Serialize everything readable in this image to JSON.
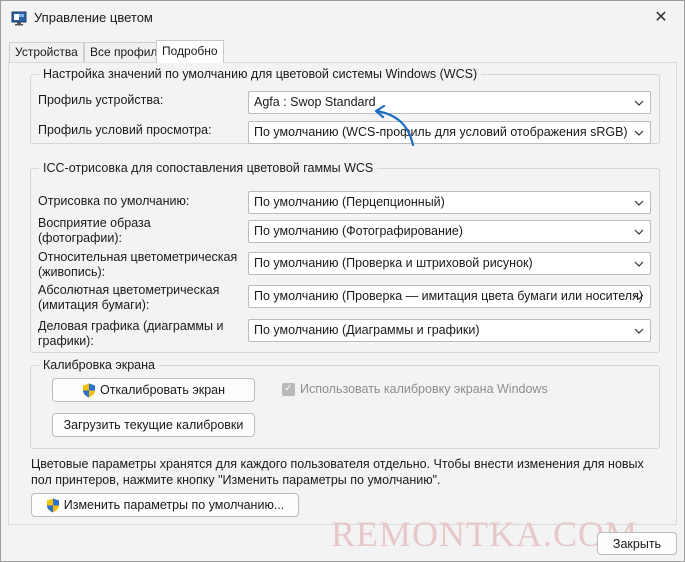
{
  "window": {
    "title": "Управление цветом",
    "close_glyph": "✕"
  },
  "tabs": [
    {
      "label": "Устройства",
      "active": false
    },
    {
      "label": "Все профили",
      "active": false
    },
    {
      "label": "Подробно",
      "active": true
    }
  ],
  "wcs_defaults": {
    "legend": "Настройка значений по умолчанию для цветовой системы Windows (WCS)",
    "rows": [
      {
        "label": "Профиль устройства:",
        "value": "Agfa : Swop Standard"
      },
      {
        "label": "Профиль условий просмотра:",
        "value": "По умолчанию (WCS-профиль для условий отображения sRGB)"
      }
    ]
  },
  "icc_mapping": {
    "legend": "ICC-отрисовка для сопоставления цветовой гаммы WCS",
    "rows": [
      {
        "label": "Отрисовка по умолчанию:",
        "value": "По умолчанию (Перцепционный)"
      },
      {
        "label": "Восприятие образа\n(фотографии):",
        "value": "По умолчанию (Фотографирование)"
      },
      {
        "label": "Относительная цветометрическая\n(живопись):",
        "value": "По умолчанию (Проверка и штриховой рисунок)"
      },
      {
        "label": "Абсолютная цветометрическая\n(имитация бумаги):",
        "value": "По умолчанию (Проверка — имитация цвета бумаги или носителя)"
      },
      {
        "label": "Деловая графика (диаграммы и\nграфики):",
        "value": "По умолчанию (Диаграммы и графики)"
      }
    ]
  },
  "calibration": {
    "legend": "Калибровка экрана",
    "calibrate_button": "Откалибровать экран",
    "load_button": "Загрузить текущие калибровки",
    "use_windows_calibration_label": "Использовать калибровку экрана Windows",
    "use_windows_calibration_checked": true
  },
  "info_text": "Цветовые параметры хранятся для каждого пользователя отдельно. Чтобы внести изменения для новых пол принтеров, нажмите кнопку \"Изменить параметры по умолчанию\".",
  "change_defaults_button": "Изменить параметры по умолчанию...",
  "close_button": "Закрыть",
  "watermark": "REMONTKA.COM",
  "colors": {
    "arrow": "#1a6fc4",
    "shield_blue": "#2f6fd1",
    "shield_yellow": "#f2c200"
  }
}
